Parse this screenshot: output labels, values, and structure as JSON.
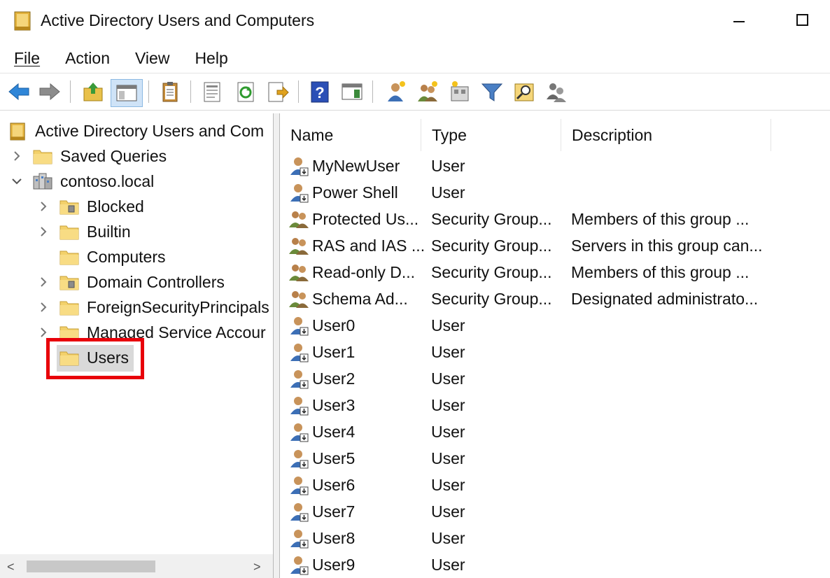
{
  "window": {
    "title": "Active Directory Users and Computers",
    "minimize_icon": "minimize-icon",
    "maximize_icon": "maximize-icon"
  },
  "menu": [
    "File",
    "Action",
    "View",
    "Help"
  ],
  "toolbar": {
    "buttons": [
      "back-icon",
      "forward-icon",
      "up-folder-icon",
      "show-console-tree-icon",
      "clipboard-icon",
      "properties-icon",
      "refresh-icon",
      "export-list-icon",
      "help-icon",
      "show-action-pane-icon",
      "new-user-icon",
      "new-group-icon",
      "new-ou-icon",
      "filter-icon",
      "find-icon",
      "add-to-group-icon"
    ]
  },
  "tree": {
    "root": "Active Directory Users and Com",
    "items": [
      {
        "label": "Saved Queries",
        "expander": "chevron-right"
      },
      {
        "label": "contoso.local",
        "expander": "chevron-down"
      },
      {
        "label": "Blocked",
        "expander": "chevron-right"
      },
      {
        "label": "Builtin",
        "expander": "chevron-right"
      },
      {
        "label": "Computers",
        "expander": ""
      },
      {
        "label": "Domain Controllers",
        "expander": "chevron-right"
      },
      {
        "label": "ForeignSecurityPrincipals",
        "expander": "chevron-right"
      },
      {
        "label": "Managed Service Accour",
        "expander": "chevron-right"
      },
      {
        "label": "Users",
        "expander": ""
      }
    ],
    "selected": "Users",
    "highlight_color": "#e8000a"
  },
  "list": {
    "columns": [
      "Name",
      "Type",
      "Description"
    ],
    "rows": [
      {
        "name": "MyNewUser",
        "type": "User",
        "description": "",
        "icon": "user-icon"
      },
      {
        "name": "Power Shell",
        "type": "User",
        "description": "",
        "icon": "user-icon"
      },
      {
        "name": "Protected Us...",
        "type": "Security Group...",
        "description": "Members of this group ...",
        "icon": "group-icon"
      },
      {
        "name": "RAS and IAS ...",
        "type": "Security Group...",
        "description": "Servers in this group can...",
        "icon": "group-icon"
      },
      {
        "name": "Read-only D...",
        "type": "Security Group...",
        "description": "Members of this group ...",
        "icon": "group-icon"
      },
      {
        "name": "Schema Ad...",
        "type": "Security Group...",
        "description": "Designated administrato...",
        "icon": "group-icon"
      },
      {
        "name": "User0",
        "type": "User",
        "description": "",
        "icon": "user-icon"
      },
      {
        "name": "User1",
        "type": "User",
        "description": "",
        "icon": "user-icon"
      },
      {
        "name": "User2",
        "type": "User",
        "description": "",
        "icon": "user-icon"
      },
      {
        "name": "User3",
        "type": "User",
        "description": "",
        "icon": "user-icon"
      },
      {
        "name": "User4",
        "type": "User",
        "description": "",
        "icon": "user-icon"
      },
      {
        "name": "User5",
        "type": "User",
        "description": "",
        "icon": "user-icon"
      },
      {
        "name": "User6",
        "type": "User",
        "description": "",
        "icon": "user-icon"
      },
      {
        "name": "User7",
        "type": "User",
        "description": "",
        "icon": "user-icon"
      },
      {
        "name": "User8",
        "type": "User",
        "description": "",
        "icon": "user-icon"
      },
      {
        "name": "User9",
        "type": "User",
        "description": "",
        "icon": "user-icon"
      }
    ]
  }
}
